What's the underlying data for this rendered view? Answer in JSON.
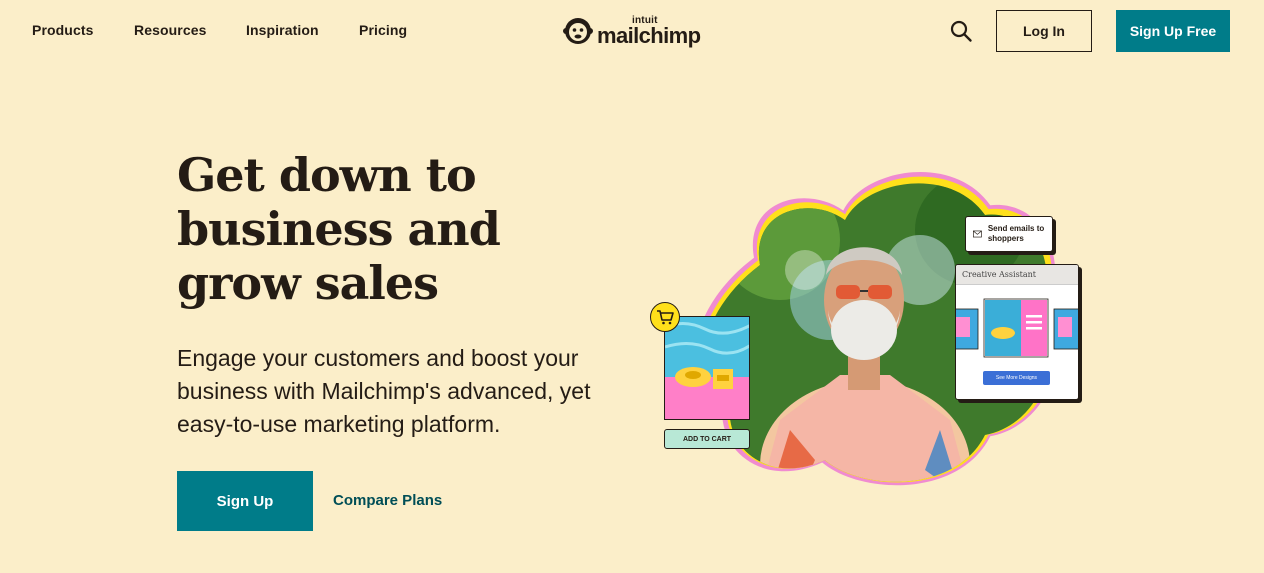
{
  "nav": {
    "items": [
      "Products",
      "Resources",
      "Inspiration",
      "Pricing"
    ],
    "logo_small": "intuit",
    "logo_word": "mailchimp",
    "login_label": "Log In",
    "signup_label": "Sign Up Free",
    "search_icon": "search-icon"
  },
  "hero": {
    "headline": "Get down to business and grow sales",
    "subheadline": "Engage your customers and boost your business with Mailchimp's advanced, yet easy-to-use marketing platform.",
    "signup_label": "Sign Up",
    "compare_label": "Compare Plans"
  },
  "illustration": {
    "send_card": "Send emails to shoppers",
    "creative_title": "Creative Assistant",
    "creative_button": "See More Designs",
    "add_to_cart": "ADD TO CART"
  },
  "colors": {
    "background": "#fbeec9",
    "teal": "#007c89",
    "text": "#241c15",
    "yellow": "#ffe01b",
    "pink": "#f08bd0"
  }
}
